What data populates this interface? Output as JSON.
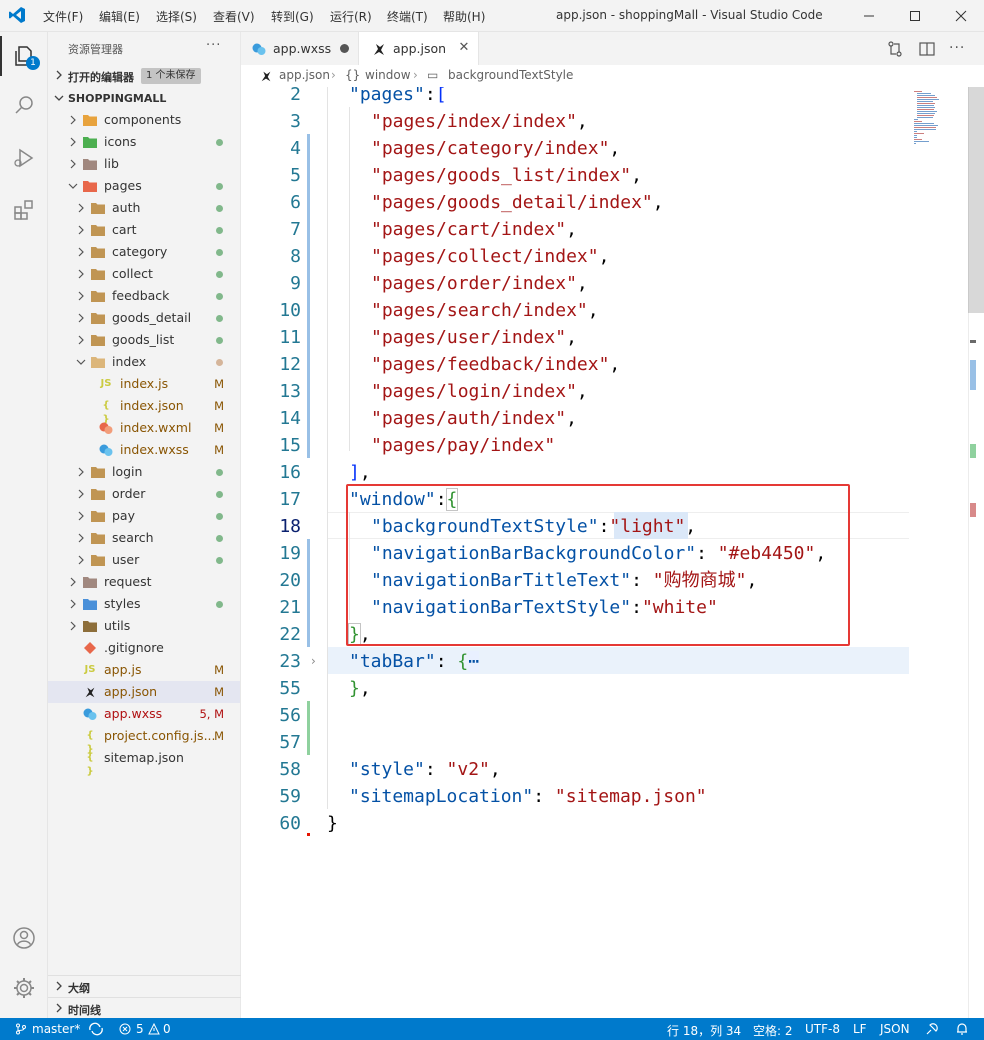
{
  "titlebar": {
    "menu": [
      "文件(F)",
      "编辑(E)",
      "选择(S)",
      "查看(V)",
      "转到(G)",
      "运行(R)",
      "终端(T)",
      "帮助(H)"
    ],
    "window_title": "app.json - shoppingMall - Visual Studio Code"
  },
  "activity": {
    "explorer_badge": "1"
  },
  "sidebar": {
    "title": "资源管理器",
    "open_editors_label": "打开的编辑器",
    "unsaved_badge": "1 个未保存",
    "project_label": "SHOPPINGMALL",
    "outline_label": "大纲",
    "timeline_label": "时间线",
    "tree": [
      {
        "name": "components",
        "status": ""
      },
      {
        "name": "icons",
        "status": ""
      },
      {
        "name": "lib",
        "status": ""
      },
      {
        "name": "pages",
        "status": ""
      },
      {
        "name": "auth",
        "status": ""
      },
      {
        "name": "cart",
        "status": ""
      },
      {
        "name": "category",
        "status": ""
      },
      {
        "name": "collect",
        "status": ""
      },
      {
        "name": "feedback",
        "status": ""
      },
      {
        "name": "goods_detail",
        "status": ""
      },
      {
        "name": "goods_list",
        "status": ""
      },
      {
        "name": "index",
        "status": ""
      },
      {
        "name": "index.js",
        "status": "M"
      },
      {
        "name": "index.json",
        "status": "M"
      },
      {
        "name": "index.wxml",
        "status": "M"
      },
      {
        "name": "index.wxss",
        "status": "M"
      },
      {
        "name": "login",
        "status": ""
      },
      {
        "name": "order",
        "status": ""
      },
      {
        "name": "pay",
        "status": ""
      },
      {
        "name": "search",
        "status": ""
      },
      {
        "name": "user",
        "status": ""
      },
      {
        "name": "request",
        "status": ""
      },
      {
        "name": "styles",
        "status": ""
      },
      {
        "name": "utils",
        "status": ""
      },
      {
        "name": ".gitignore",
        "status": ""
      },
      {
        "name": "app.js",
        "status": "M"
      },
      {
        "name": "app.json",
        "status": "M"
      },
      {
        "name": "app.wxss",
        "status": "5, M"
      },
      {
        "name": "project.config.js...",
        "status": "M"
      },
      {
        "name": "sitemap.json",
        "status": ""
      }
    ]
  },
  "tabs": [
    {
      "label": "app.wxss"
    },
    {
      "label": "app.json"
    }
  ],
  "breadcrumb": {
    "file": "app.json",
    "braces": "{}",
    "window": "window",
    "prop_icon": "▭",
    "field": "backgroundTextStyle"
  },
  "editor": {
    "line_numbers": [
      "2",
      "3",
      "4",
      "5",
      "6",
      "7",
      "8",
      "9",
      "10",
      "11",
      "12",
      "13",
      "14",
      "15",
      "16",
      "17",
      "18",
      "19",
      "20",
      "21",
      "22",
      "23",
      "55",
      "56",
      "57",
      "58",
      "59",
      "60"
    ],
    "pages_key": "\"pages\"",
    "pages": [
      "\"pages/index/index\"",
      "\"pages/category/index\"",
      "\"pages/goods_list/index\"",
      "\"pages/goods_detail/index\"",
      "\"pages/cart/index\"",
      "\"pages/collect/index\"",
      "\"pages/order/index\"",
      "\"pages/search/index\"",
      "\"pages/user/index\"",
      "\"pages/feedback/index\"",
      "\"pages/login/index\"",
      "\"pages/auth/index\"",
      "\"pages/pay/index\""
    ],
    "window_key": "\"window\"",
    "bg_text_style_key": "\"backgroundTextStyle\"",
    "bg_text_style_val": "\"light\"",
    "nav_bg_key": "\"navigationBarBackgroundColor\"",
    "nav_bg_val": "\"#eb4450\"",
    "nav_title_key": "\"navigationBarTitleText\"",
    "nav_title_val": "\"购物商城\"",
    "nav_text_key": "\"navigationBarTextStyle\"",
    "nav_text_val": "\"white\"",
    "tabbar_key": "\"tabBar\"",
    "folded": "⋯",
    "style_key": "\"style\"",
    "style_val": "\"v2\"",
    "sitemap_key": "\"sitemapLocation\"",
    "sitemap_val": "\"sitemap.json\""
  },
  "statusbar": {
    "branch": "master*",
    "errors": "5",
    "warnings": "0",
    "position": "行 18，列 34",
    "indent": "空格: 2",
    "encoding": "UTF-8",
    "eol": "LF",
    "language": "JSON"
  },
  "colors": {
    "accent": "#007acc",
    "highlight_box": "#e53935",
    "modified": "#895503",
    "added_dot": "#81b88b"
  }
}
